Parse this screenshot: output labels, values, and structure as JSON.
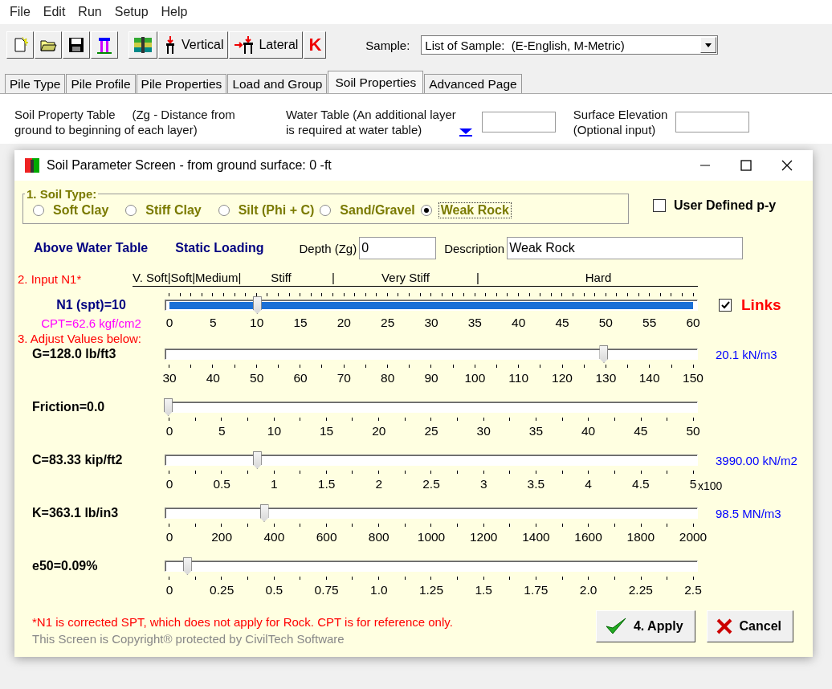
{
  "menu": [
    "File",
    "Edit",
    "Run",
    "Setup",
    "Help"
  ],
  "toolbar": {
    "buttons": [
      {
        "kind": "new"
      },
      {
        "kind": "open"
      },
      {
        "kind": "save"
      },
      {
        "kind": "pile"
      },
      {
        "kind": "soil"
      },
      {
        "kind": "vertical",
        "label": "Vertical"
      },
      {
        "kind": "lateral",
        "label": "Lateral"
      },
      {
        "kind": "k",
        "label": "K"
      }
    ],
    "sample_label": "Sample:",
    "sample_value": "List of Sample:  (E-English, M-Metric)"
  },
  "tabs": [
    {
      "label": "Pile Type",
      "selected": false
    },
    {
      "label": "Pile Profile",
      "selected": false
    },
    {
      "label": "Pile Properties",
      "selected": false
    },
    {
      "label": "Load and Group",
      "selected": false
    },
    {
      "label": "Soil Properties",
      "selected": true
    },
    {
      "label": "Advanced Page",
      "selected": false
    }
  ],
  "info": {
    "soil_table": [
      "Soil Property Table     (Zg - Distance from",
      "ground to beginning of each layer)"
    ],
    "water_table": [
      "Water Table (An additional layer",
      "is required at water table)"
    ],
    "surface_elevation": [
      "Surface Elevation",
      "(Optional input)"
    ]
  },
  "dialog": {
    "title": "Soil Parameter Screen - from ground surface: 0 -ft",
    "soil_type": {
      "legend": "1. Soil Type:",
      "options": [
        {
          "label": "Soft Clay",
          "selected": false
        },
        {
          "label": "Stiff Clay",
          "selected": false
        },
        {
          "label": "Silt (Phi + C)",
          "selected": false
        },
        {
          "label": "Sand/Gravel",
          "selected": false
        },
        {
          "label": "Weak Rock",
          "selected": true
        }
      ]
    },
    "user_defined_py": {
      "label": "User Defined p-y",
      "checked": false
    },
    "water_state": "Above Water Table",
    "loading": "Static Loading",
    "depth": {
      "label": "Depth (Zg)",
      "value": "0"
    },
    "description": {
      "label": "Description",
      "value": "Weak Rock"
    },
    "n1": {
      "heading": "2. Input N1*",
      "categories": [
        "V. Soft|Soft|Medium|",
        "Stiff",
        "|",
        "Very Stiff",
        "|",
        "Hard"
      ],
      "label": "N1 (spt)=10",
      "cpt": "CPT=62.6 kgf/cm2",
      "level": 0.167,
      "ticks": [
        "0",
        "5",
        "10",
        "15",
        "20",
        "25",
        "30",
        "35",
        "40",
        "45",
        "50",
        "55",
        "60"
      ]
    },
    "links": {
      "label": "Links",
      "checked": true
    },
    "adjust_heading": "3. Adjust Values below:",
    "sliders": [
      {
        "label": "G=128.0 lb/ft3",
        "level": 0.817,
        "reading": "20.1 kN/m3",
        "ticks": [
          "30",
          "40",
          "50",
          "60",
          "70",
          "80",
          "90",
          "100",
          "110",
          "120",
          "130",
          "140",
          "150"
        ]
      },
      {
        "label": "Friction=0.0",
        "level": 0,
        "ticks": [
          "0",
          "5",
          "10",
          "15",
          "20",
          "25",
          "30",
          "35",
          "40",
          "45",
          "50"
        ]
      },
      {
        "label": "C=83.33 kip/ft2",
        "level": 0.167,
        "reading": "3990.00 kN/m2",
        "suffix": "x100",
        "ticks": [
          "0",
          "0.5",
          "1",
          "1.5",
          "2",
          "2.5",
          "3",
          "3.5",
          "4",
          "4.5",
          "5"
        ]
      },
      {
        "label": "K=363.1 lb/in3",
        "level": 0.18,
        "reading": "98.5 MN/m3",
        "ticks": [
          "0",
          "200",
          "400",
          "600",
          "800",
          "1000",
          "1200",
          "1400",
          "1600",
          "1800",
          "2000"
        ]
      },
      {
        "label": "e50=0.09%",
        "level": 0.036,
        "ticks": [
          "0",
          "0.25",
          "0.5",
          "0.75",
          "1.0",
          "1.25",
          "1.5",
          "1.75",
          "2.0",
          "2.25",
          "2.5"
        ]
      }
    ],
    "note": "*N1 is corrected SPT, which does not apply for Rock.  CPT is for reference only.",
    "copyright": "This Screen is Copyright® protected by CivilTech Software",
    "apply": "4. Apply",
    "cancel": "Cancel"
  }
}
